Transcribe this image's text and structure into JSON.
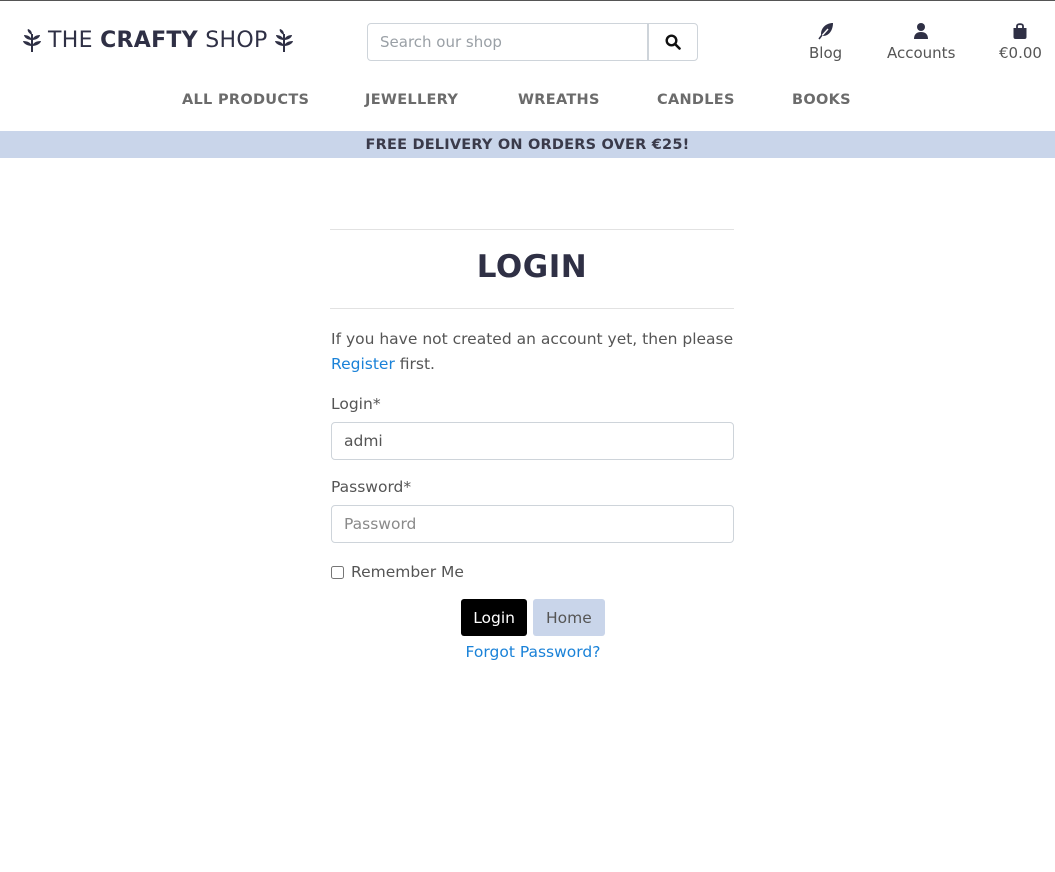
{
  "brand": {
    "prefix": "THE ",
    "bold": "CRAFTY",
    "suffix": " SHOP"
  },
  "search": {
    "placeholder": "Search our shop",
    "value": ""
  },
  "header_links": [
    {
      "label": "Blog",
      "icon": "feather-icon"
    },
    {
      "label": "Accounts",
      "icon": "user-icon"
    },
    {
      "label": "€0.00",
      "icon": "shopping-bag-icon"
    }
  ],
  "main_nav": [
    "ALL PRODUCTS",
    "JEWELLERY",
    "WREATHS",
    "CANDLES",
    "BOOKS"
  ],
  "banner": "FREE DELIVERY ON ORDERS OVER €25!",
  "login": {
    "title": "LOGIN",
    "intro_before": "If you have not created an account yet, then please",
    "register_link": "Register",
    "intro_after": " first.",
    "login_label": "Login*",
    "login_value": "admi",
    "password_label": "Password*",
    "password_placeholder": "Password",
    "remember_label": "Remember Me",
    "remember_checked": false,
    "login_button": "Login",
    "home_button": "Home",
    "forgot_link": "Forgot Password?"
  },
  "colors": {
    "banner_bg": "#c9d5ea",
    "link": "#1a82d8",
    "primary_button": "#000000"
  }
}
